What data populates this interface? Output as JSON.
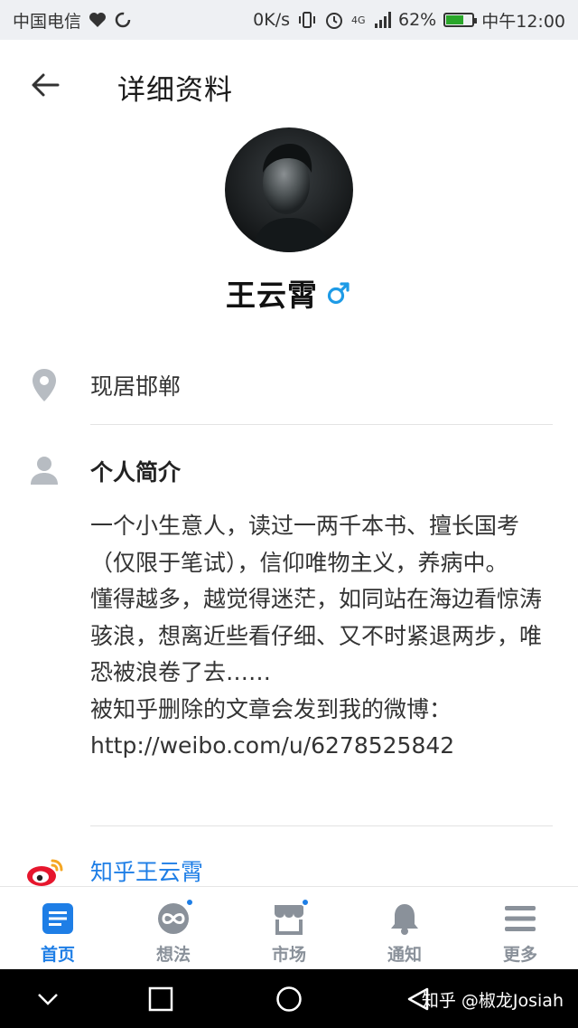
{
  "status_bar": {
    "carrier": "中国电信",
    "speed": "0K/s",
    "network": "4G",
    "battery": "62%",
    "time": "中午12:00"
  },
  "header": {
    "title": "详细资料"
  },
  "profile": {
    "name": "王云霄",
    "gender_icon": "male-icon"
  },
  "location": {
    "text": "现居邯郸"
  },
  "bio": {
    "title": "个人简介",
    "text": "一个小生意人，读过一两千本书、擅长国考（仅限于笔试），信仰唯物主义，养病中。\n懂得越多，越觉得迷茫，如同站在海边看惊涛骇浪，想离近些看仔细、又不时紧退两步，唯恐被浪卷了去……\n被知乎删除的文章会发到我的微博：http://weibo.com/u/6278525842"
  },
  "weibo": {
    "label": "知乎王云霄"
  },
  "tabs": [
    {
      "label": "首页",
      "icon": "home-icon"
    },
    {
      "label": "想法",
      "icon": "ideas-icon"
    },
    {
      "label": "市场",
      "icon": "market-icon"
    },
    {
      "label": "通知",
      "icon": "bell-icon"
    },
    {
      "label": "更多",
      "icon": "menu-icon"
    }
  ],
  "watermark": "知乎 @椒龙Josiah",
  "colors": {
    "accent": "#1e7ee6",
    "weibo_red": "#e6162d",
    "tab_inactive": "#8a919a"
  }
}
